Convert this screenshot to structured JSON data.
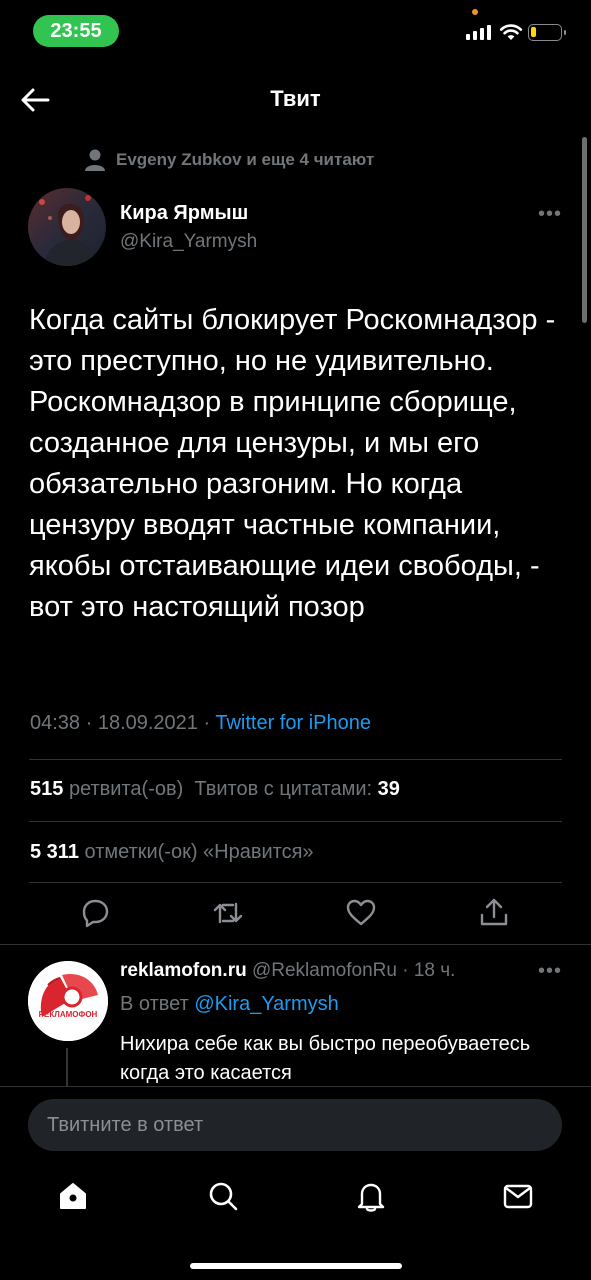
{
  "status_bar": {
    "time": "23:55",
    "accent": "#31c451"
  },
  "header": {
    "title": "Твит",
    "back_icon": "arrow-left-icon"
  },
  "social_context": {
    "text": "Evgeny Zubkov и еще 4 читают",
    "icon": "person-icon"
  },
  "tweet": {
    "author_name": "Кира Ярмыш",
    "author_handle": "@Kira_Yarmysh",
    "text": "Когда сайты блокирует Роскомнадзор - это преступно, но не удивительно. Роскомнадзор в принципе сборище, созданное для цензуры, и мы его обязательно разгоним. Но когда цензуру вводят частные компании, якобы отстаивающие идеи свободы, - вот это настоящий позор",
    "timestamp": "04:38 · 18.09.2021 · ",
    "source": "Twitter for iPhone"
  },
  "stats": {
    "retweets_count": "515",
    "retweets_label": "ретвита(-ов)",
    "quotes_label": "Твитов с цитатами:",
    "quotes_count": "39",
    "likes_count": "5 311",
    "likes_label": "отметки(-ок) «Нравится»"
  },
  "actions": [
    "reply-icon",
    "retweet-icon",
    "like-icon",
    "share-icon"
  ],
  "reply": {
    "name": "reklamofon.ru",
    "handle": "@ReklamofonRu · 18 ч.",
    "reply_to_label": "В ответ ",
    "reply_to_mention": "@Kira_Yarmysh",
    "text": "Нихира себе как вы быстро переобуваетесь когда это касается",
    "avatar_logo_text": "РЕКЛАМОФОН"
  },
  "compose": {
    "placeholder": "Твитните в ответ"
  },
  "tab_bar": [
    "home-icon",
    "search-icon",
    "notifications-icon",
    "messages-icon"
  ],
  "colors": {
    "link": "#1d9bf0",
    "muted": "#71767b",
    "battery": "#ffd60a"
  }
}
